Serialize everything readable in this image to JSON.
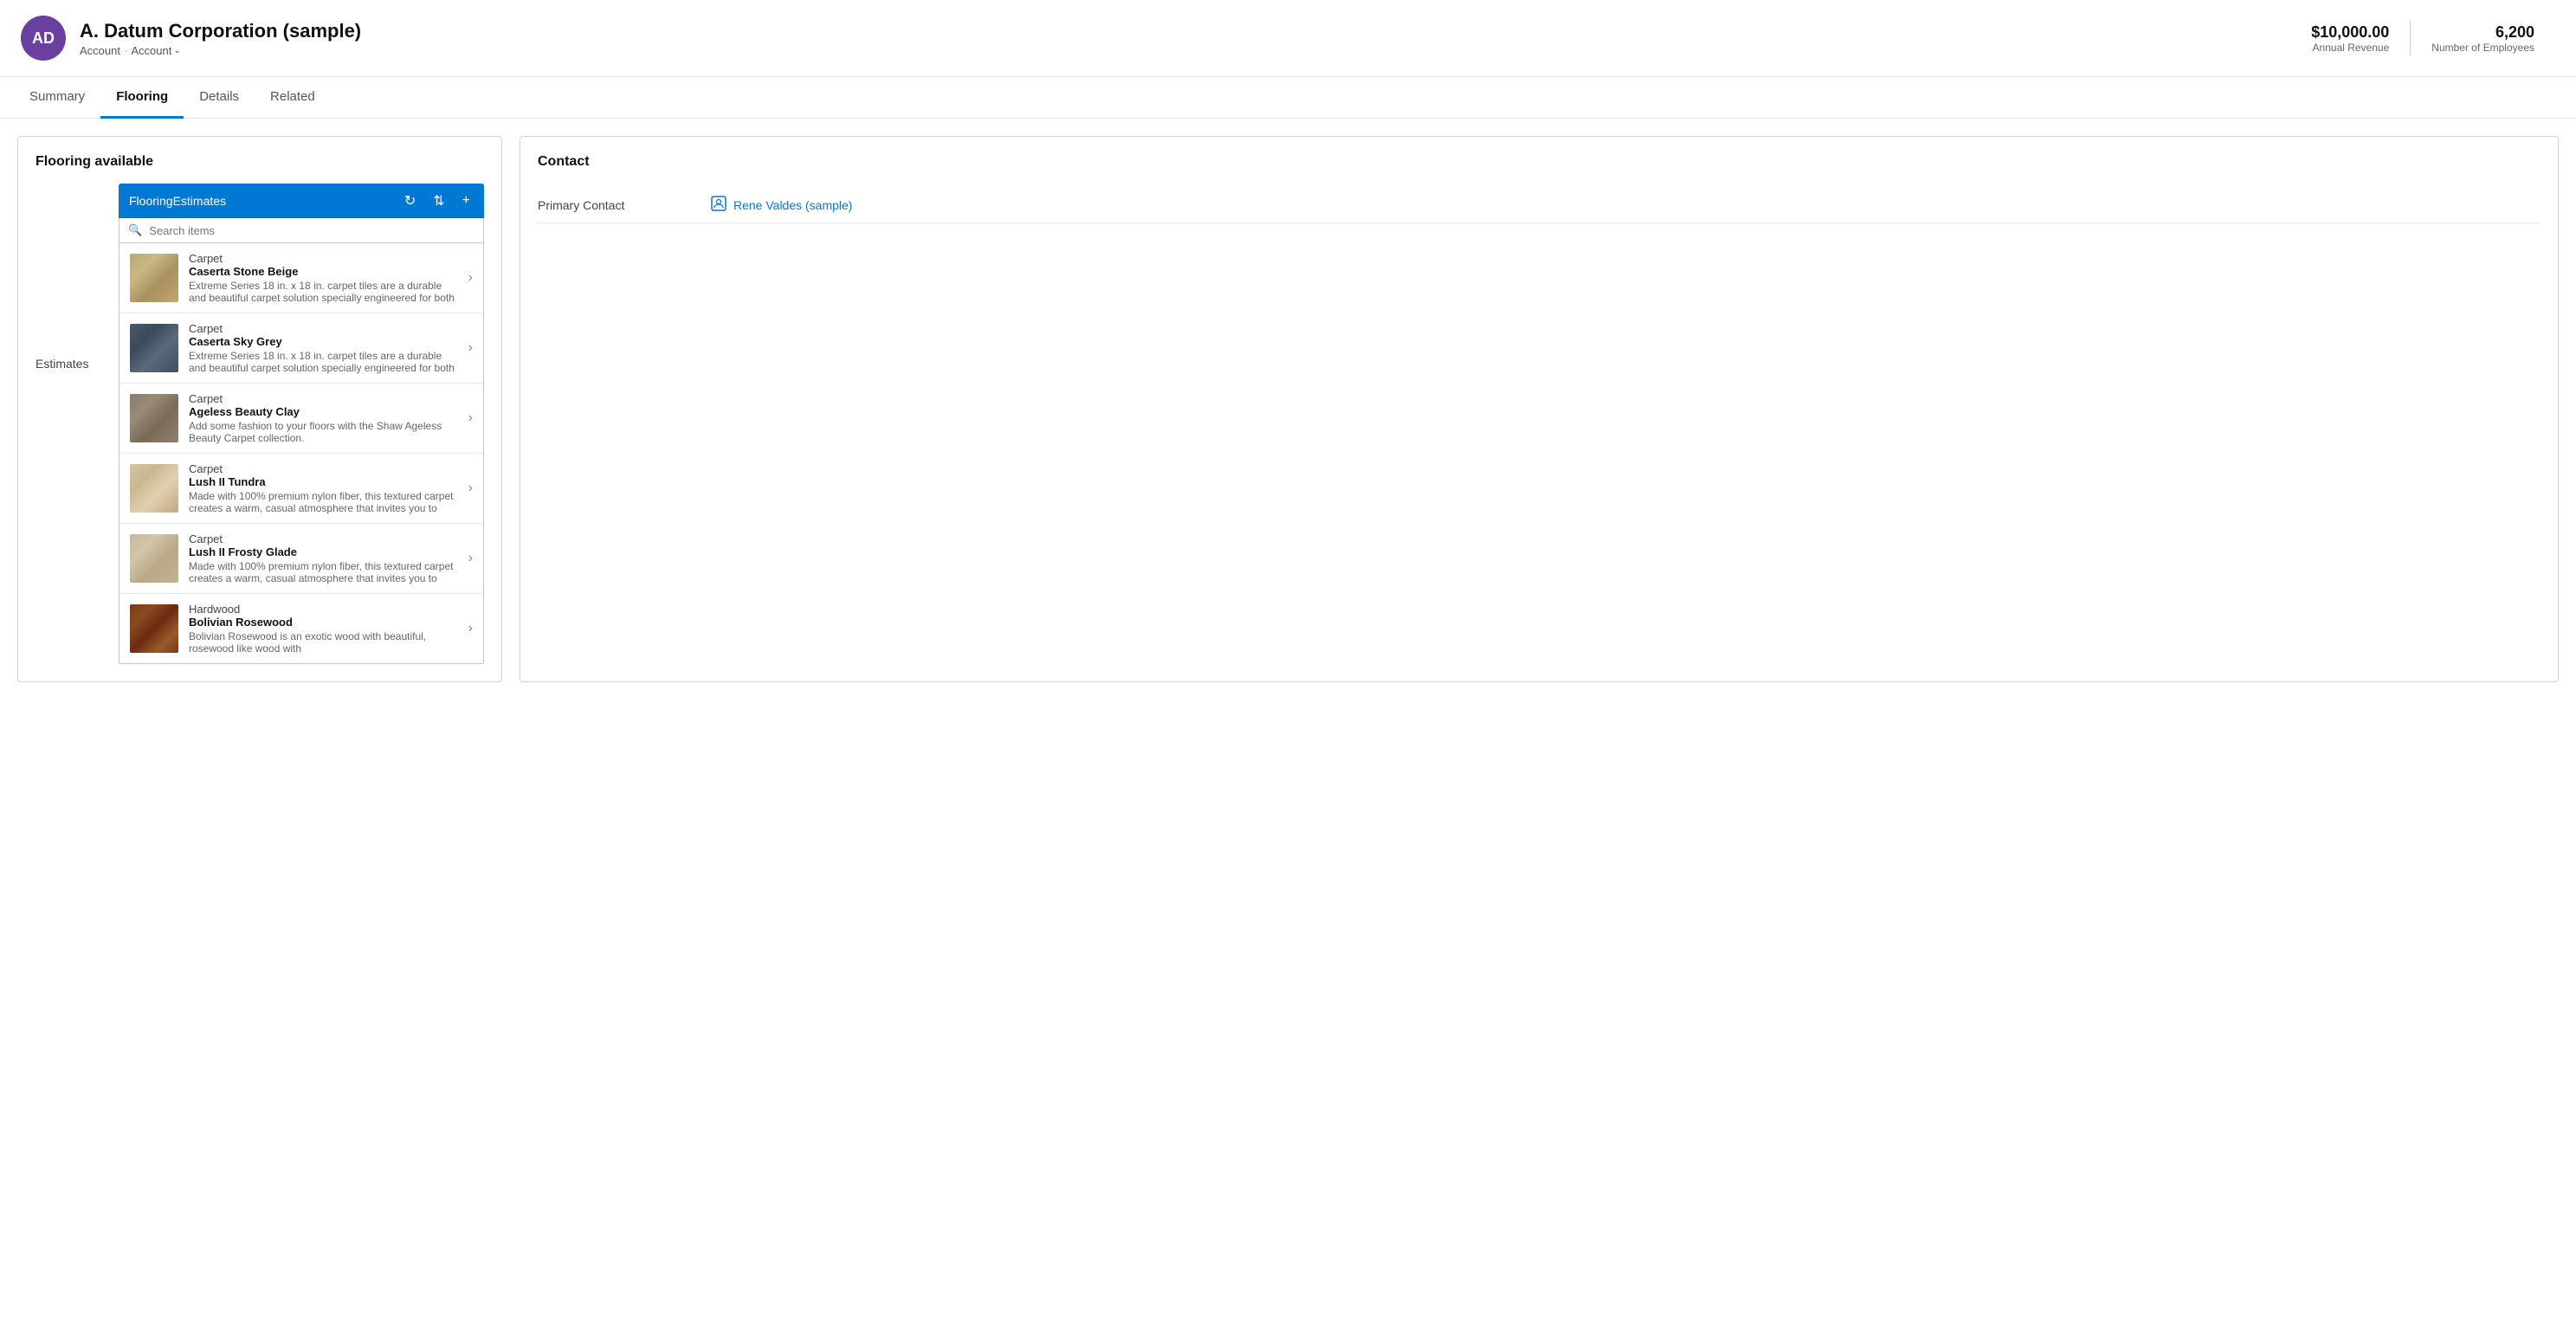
{
  "header": {
    "initials": "AD",
    "company_name": "A. Datum Corporation (sample)",
    "breadcrumb1": "Account",
    "breadcrumb2": "Account",
    "annual_revenue_value": "$10,000.00",
    "annual_revenue_label": "Annual Revenue",
    "employees_value": "6,200",
    "employees_label": "Number of Employees"
  },
  "nav": {
    "tabs": [
      {
        "label": "Summary",
        "active": false
      },
      {
        "label": "Flooring",
        "active": true
      },
      {
        "label": "Details",
        "active": false
      },
      {
        "label": "Related",
        "active": false
      }
    ]
  },
  "left_panel": {
    "title": "Flooring available",
    "toolbar_title": "FlooringEstimates",
    "search_placeholder": "Search items",
    "section_label": "Estimates",
    "items": [
      {
        "type": "Carpet",
        "name": "Caserta Stone Beige",
        "desc": "Extreme Series 18 in. x 18 in. carpet tiles are a durable and beautiful carpet solution specially engineered for both",
        "thumb_class": "thumb-caserta-beige"
      },
      {
        "type": "Carpet",
        "name": "Caserta Sky Grey",
        "desc": "Extreme Series 18 in. x 18 in. carpet tiles are a durable and beautiful carpet solution specially engineered for both",
        "thumb_class": "thumb-caserta-grey"
      },
      {
        "type": "Carpet",
        "name": "Ageless Beauty Clay",
        "desc": "Add some fashion to your floors with the Shaw Ageless Beauty Carpet collection.",
        "thumb_class": "thumb-ageless-clay"
      },
      {
        "type": "Carpet",
        "name": "Lush II Tundra",
        "desc": "Made with 100% premium nylon fiber, this textured carpet creates a warm, casual atmosphere that invites you to",
        "thumb_class": "thumb-lush-tundra"
      },
      {
        "type": "Carpet",
        "name": "Lush II Frosty Glade",
        "desc": "Made with 100% premium nylon fiber, this textured carpet creates a warm, casual atmosphere that invites you to",
        "thumb_class": "thumb-lush-frosty"
      },
      {
        "type": "Hardwood",
        "name": "Bolivian Rosewood",
        "desc": "Bolivian Rosewood is an exotic wood with beautiful, rosewood like wood with",
        "thumb_class": "thumb-hardwood"
      }
    ]
  },
  "right_panel": {
    "title": "Contact",
    "primary_contact_label": "Primary Contact",
    "primary_contact_name": "Rene Valdes (sample)"
  },
  "icons": {
    "refresh": "↻",
    "sort": "⇅",
    "add": "+",
    "search": "🔍",
    "chevron_right": "›",
    "chevron_down": "⌄",
    "contact_icon": "👤"
  }
}
